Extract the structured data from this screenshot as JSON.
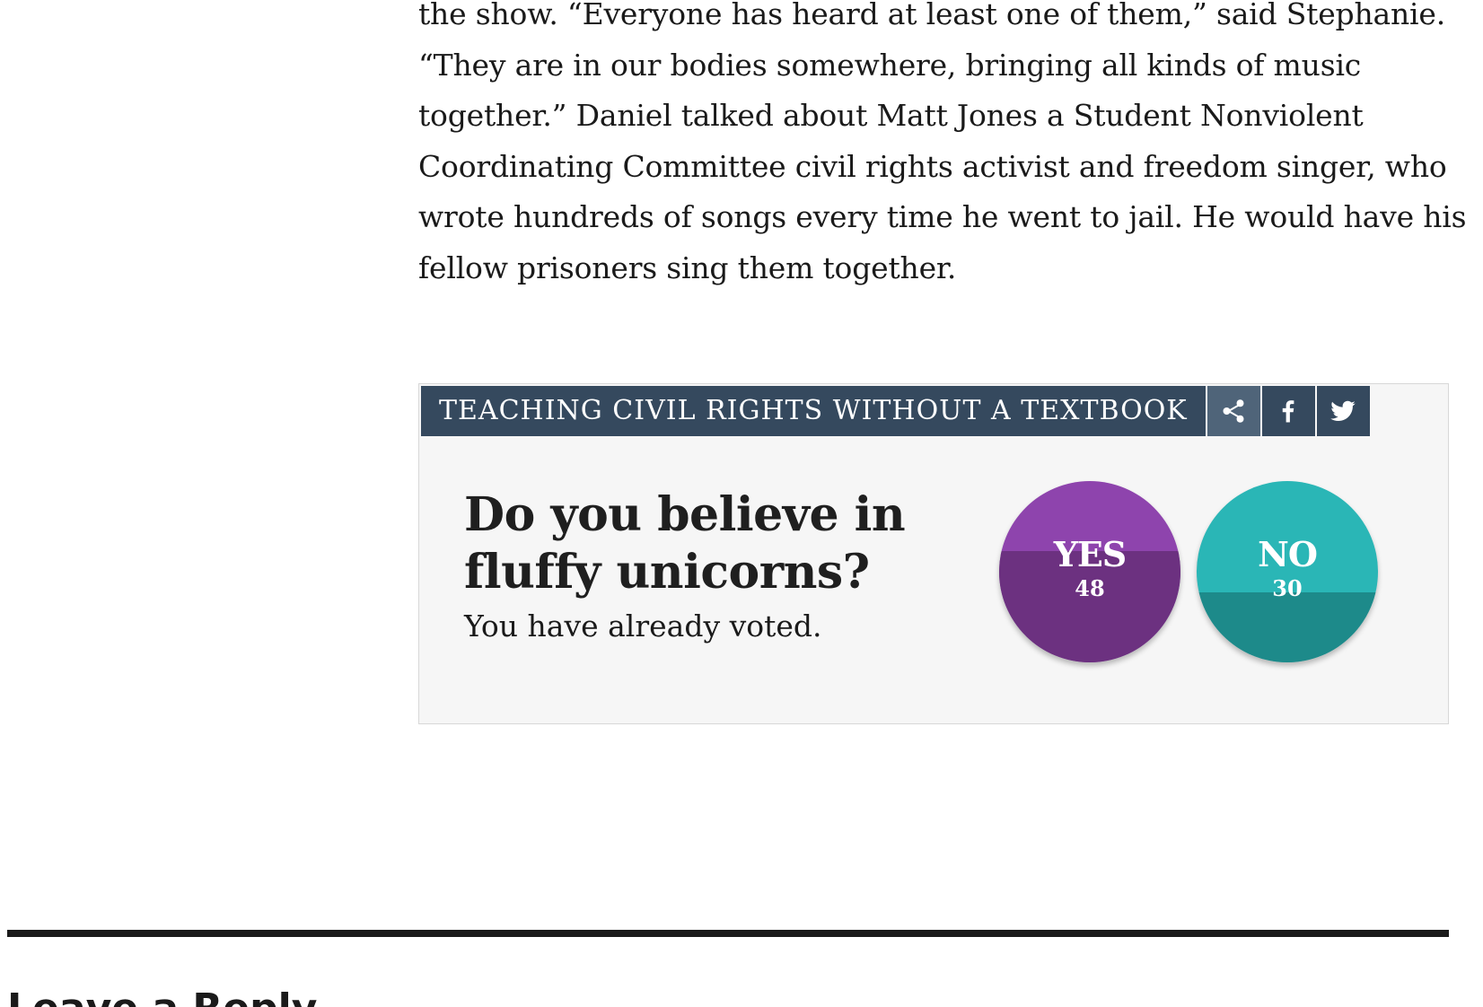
{
  "article": {
    "lines": [
      "the show. “Everyone has heard at least one of them,” said Stephanie.",
      "“They are in our bodies somewhere, bringing all kinds of music",
      "together.” Daniel talked about Matt Jones a Student Nonviolent",
      "Coordinating Committee civil rights activist and freedom singer, who",
      "wrote hundreds of songs every time he went to jail. He would have his",
      "fellow prisoners sing them together."
    ]
  },
  "poll": {
    "title": "TEACHING CIVIL RIGHTS WITHOUT A TEXTBOOK",
    "share_icons": [
      "share-icon",
      "facebook-icon",
      "twitter-icon"
    ],
    "question": "Do you believe in fluffy unicorns?",
    "status": "You have already voted.",
    "options": [
      {
        "label": "YES",
        "votes": "48",
        "share": 0.615,
        "color_light": "#8e44ad",
        "color_dark": "#6c3180"
      },
      {
        "label": "NO",
        "votes": "30",
        "share": 0.385,
        "color_light": "#2ab6b6",
        "color_dark": "#1d8a8a"
      }
    ],
    "header_color": "#35495e"
  },
  "reply": {
    "heading": "Leave a Reply"
  }
}
